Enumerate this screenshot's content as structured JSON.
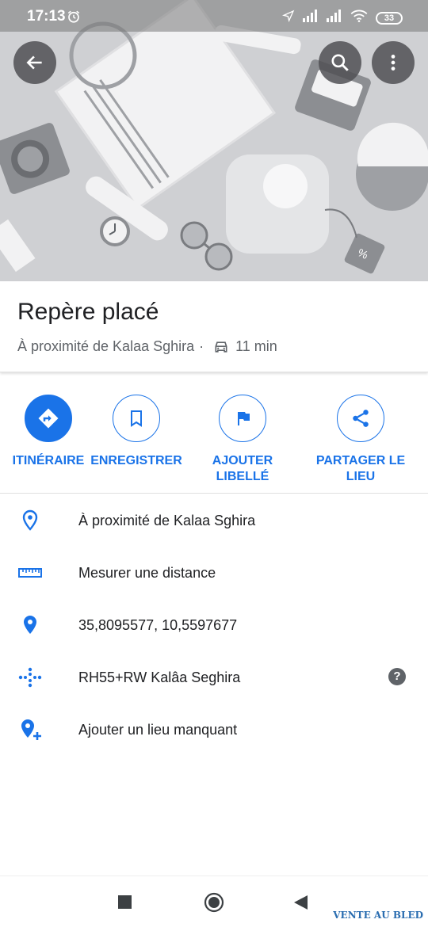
{
  "status_bar": {
    "time": "17:13",
    "battery": "33"
  },
  "place": {
    "title": "Repère placé",
    "subtitle_location": "À proximité de Kalaa Sghira",
    "drive_time": "11 min"
  },
  "actions": [
    {
      "label": "ITINÉRAIRE",
      "icon": "directions-icon"
    },
    {
      "label": "ENREGISTRER",
      "icon": "bookmark-icon"
    },
    {
      "label": "AJOUTER LIBELLÉ",
      "icon": "flag-icon"
    },
    {
      "label": "PARTAGER LE LIEU",
      "icon": "share-icon"
    }
  ],
  "details": [
    {
      "text": "À proximité de Kalaa Sghira",
      "icon": "location-outline-icon"
    },
    {
      "text": "Mesurer une distance",
      "icon": "ruler-icon"
    },
    {
      "text": "35,8095577, 10,5597677",
      "icon": "location-pin-icon"
    },
    {
      "text": "RH55+RW Kalâa Seghira",
      "icon": "plus-code-icon"
    },
    {
      "text": "Ajouter un lieu manquant",
      "icon": "add-place-icon"
    }
  ],
  "watermark": "VENTE AU BLED",
  "colors": {
    "accent": "#1a73e8",
    "text": "#202124",
    "secondary": "#5f6368"
  }
}
